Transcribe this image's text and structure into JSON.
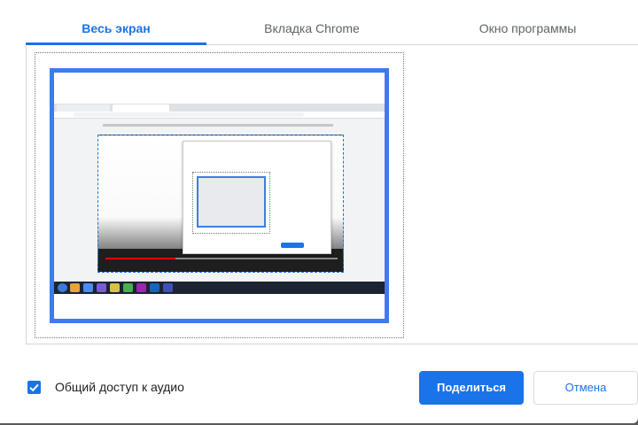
{
  "tabs": [
    {
      "label": "Весь экран",
      "active": true
    },
    {
      "label": "Вкладка Chrome",
      "active": false
    },
    {
      "label": "Окно программы",
      "active": false
    }
  ],
  "footer": {
    "audio_checkbox_checked": true,
    "audio_label": "Общий доступ к аудио",
    "share_label": "Поделиться",
    "cancel_label": "Отмена"
  },
  "colors": {
    "accent": "#1a73e8",
    "selection_border": "#3b7de9"
  }
}
